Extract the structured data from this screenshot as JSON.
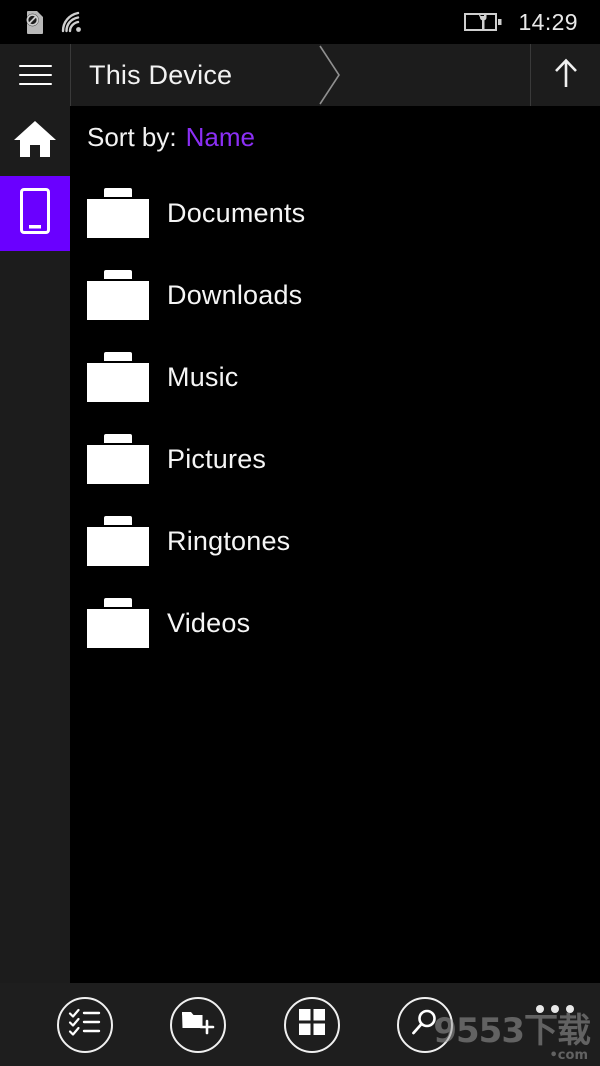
{
  "status_bar": {
    "sim_icon": "no-sim-icon",
    "wifi_icon": "wifi-icon",
    "battery_icon": "battery-charging-icon",
    "time": "14:29"
  },
  "header": {
    "menu_icon": "hamburger-menu-icon",
    "breadcrumb": "This Device",
    "separator_icon": "chevron-right-icon",
    "up_label": "up-arrow-icon"
  },
  "rail": {
    "items": [
      {
        "name": "home",
        "icon": "home-icon",
        "active": false
      },
      {
        "name": "this-device",
        "icon": "phone-icon",
        "active": true
      }
    ],
    "active_color": "#6A00FF"
  },
  "sort": {
    "label": "Sort by:",
    "value": "Name",
    "value_color": "#8B2FF5"
  },
  "files": {
    "items": [
      {
        "name": "Documents",
        "icon": "folder-icon"
      },
      {
        "name": "Downloads",
        "icon": "folder-icon"
      },
      {
        "name": "Music",
        "icon": "folder-icon"
      },
      {
        "name": "Pictures",
        "icon": "folder-icon"
      },
      {
        "name": "Ringtones",
        "icon": "folder-icon"
      },
      {
        "name": "Videos",
        "icon": "folder-icon"
      }
    ]
  },
  "appbar": {
    "buttons": [
      {
        "name": "select-items",
        "icon": "checklist-icon"
      },
      {
        "name": "new-folder",
        "icon": "folder-add-icon"
      },
      {
        "name": "view-mode",
        "icon": "grid-view-icon"
      },
      {
        "name": "search",
        "icon": "search-icon"
      }
    ],
    "overflow_icon": "ellipsis-icon"
  },
  "watermark": {
    "text": "9553下载",
    "sub": "•com"
  },
  "theme": {
    "background": "#000000",
    "chrome": "#1C1C1C",
    "accent": "#6A00FF",
    "text": "#F2F2F2"
  }
}
